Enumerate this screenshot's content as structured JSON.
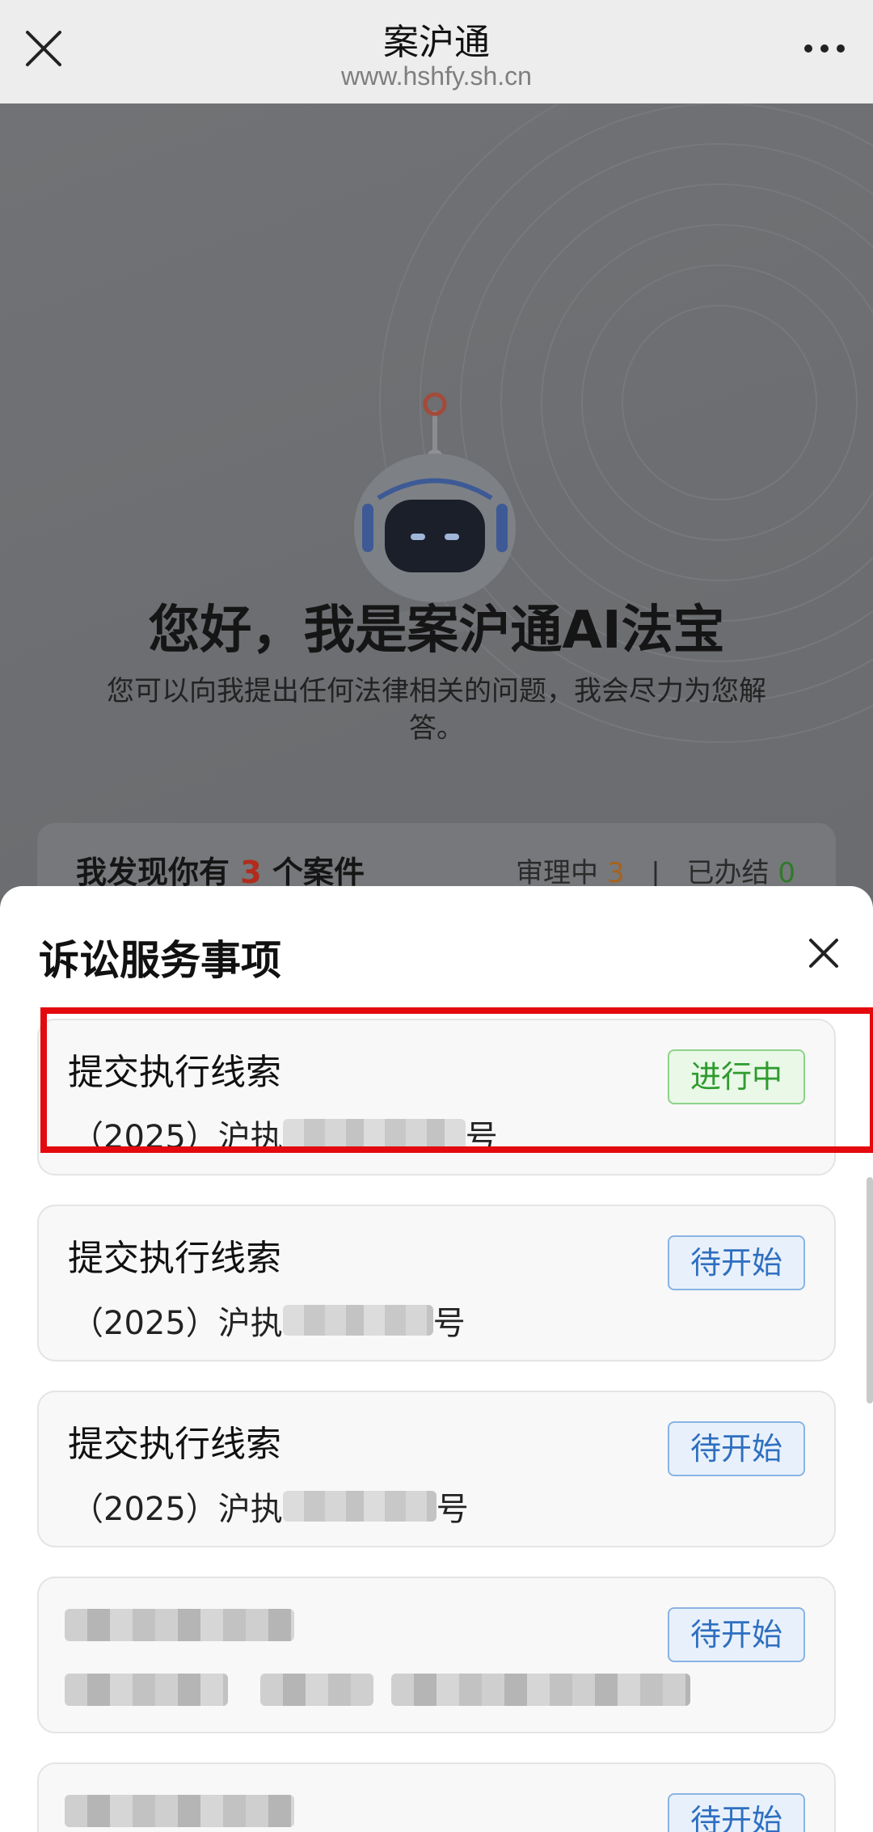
{
  "header": {
    "title": "案沪通",
    "url": "www.hshfy.sh.cn"
  },
  "background": {
    "greeting": "您好，我是案沪通AI法宝",
    "description": "您可以向我提出任何法律相关的问题，我会尽力为您解答。",
    "cases": {
      "prefix": "我发现你有",
      "count": "3",
      "suffix": "个案件",
      "reviewing_label": "审理中",
      "reviewing_count": "3",
      "separator": "|",
      "closed_label": "已办结",
      "closed_count": "0"
    }
  },
  "sheet": {
    "title": "诉讼服务事项",
    "items": [
      {
        "name": "提交执行线索",
        "code_prefix": "（2025）沪执",
        "code_suffix": "号",
        "status": "进行中",
        "status_type": "running"
      },
      {
        "name": "提交执行线索",
        "code_prefix": "（2025）沪执",
        "code_suffix": "号",
        "status": "待开始",
        "status_type": "waiting"
      },
      {
        "name": "提交执行线索",
        "code_prefix": "（2025）沪执",
        "code_suffix": "号",
        "status": "待开始",
        "status_type": "waiting"
      },
      {
        "name": "",
        "code_prefix": "",
        "code_suffix": "",
        "status": "待开始",
        "status_type": "waiting"
      },
      {
        "name": "",
        "code_prefix": "",
        "code_suffix": "",
        "status": "待开始",
        "status_type": "waiting"
      }
    ]
  },
  "colors": {
    "highlight": "#e3090e",
    "running": "#2e9b2e",
    "waiting": "#2f6fc0"
  },
  "icons": {
    "close": "close-icon",
    "more": "more-icon",
    "sheet_close": "close-icon"
  }
}
